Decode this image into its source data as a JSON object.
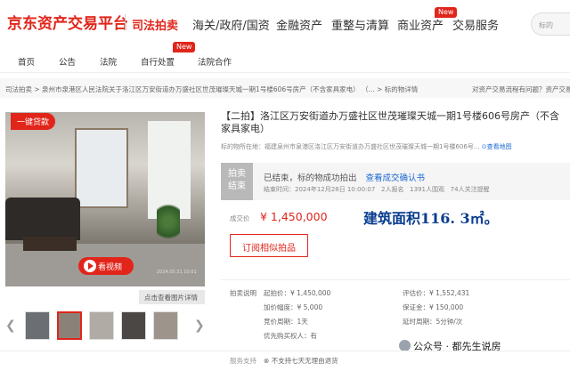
{
  "header": {
    "logo": "京东资产交易平台",
    "nav": [
      "司法拍卖",
      "海关/政府/国资",
      "金融资产",
      "重整与清算",
      "商业资产",
      "交易服务"
    ],
    "nav_badge": "New",
    "search_placeholder": "标的"
  },
  "subnav": {
    "items": [
      "首页",
      "公告",
      "法院",
      "自行处置",
      "法院合作"
    ],
    "badge": "New"
  },
  "breadcrumb": {
    "text": "司法拍卖 > 泉州市泉港区人民法院关于洛江区万安街道办万盛社区世茂璀璨天城一期1号楼606号房产（不含家具家电） （... > 标的物详情",
    "right": "对资产交易流程有问题？资产交易"
  },
  "gallery": {
    "loan_tag": "一键贷款",
    "video_label": "看视频",
    "stamp": "2024.05.31 10:01",
    "detail_link": "点击查看图片详情"
  },
  "listing": {
    "title": "【二拍】洛江区万安街道办万盛社区世茂璀璨天城一期1号楼606号房产（不含家具家电）",
    "address_label": "标的物所在地：",
    "address": "福建泉州市泉港区洛江区万安街道办万盛社区世茂璀璨天城一期1号楼606号...",
    "map_link": "查看地图",
    "status_tag": "拍卖结束",
    "status_text": "已结束，标的物成功拍出",
    "status_link": "查看成交确认书",
    "end_time": "结束时间：2024年12月28日 10:00:07",
    "sign_ups": "2人报名",
    "watchers": "1391人围观",
    "followers": "74人关注提醒",
    "price_label": "成交价",
    "price": "¥ 1,450,000",
    "area_overlay": "建筑面积116. 3㎡。",
    "subscribe": "订阅相似拍品"
  },
  "details": {
    "section_label": "拍卖说明",
    "start_price": "起拍价：¥ 1,450,000",
    "appraisal": "评估价：¥ 1,552,431",
    "increment": "加价幅度：¥ 5,000",
    "deposit": "保证金：¥ 150,000",
    "bid_cycle": "竞价周期：1天",
    "delay_cycle": "延时周期：5分钟/次",
    "priority": "优先购买权人：有"
  },
  "footer": {
    "service_label": "服务支持",
    "service_text": "不支持七天无理由退货"
  },
  "watermark": "公众号 · 都先生说房",
  "colors": {
    "brand": "#e1251b",
    "link": "#1c69d4"
  }
}
